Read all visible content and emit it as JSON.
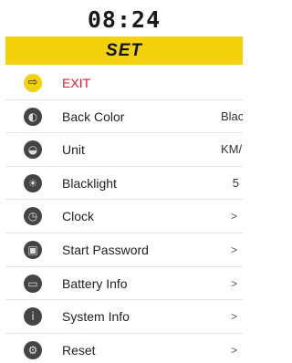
{
  "status": {
    "time": "08:24"
  },
  "header": {
    "title": "SET"
  },
  "menu": {
    "items": [
      {
        "label": "EXIT",
        "value": "",
        "icon": "exit-icon"
      },
      {
        "label": "Back Color",
        "value": "Black",
        "icon": "palette-icon"
      },
      {
        "label": "Unit",
        "value": "KM/H",
        "icon": "speedometer-icon"
      },
      {
        "label": "Blacklight",
        "value": "5",
        "icon": "brightness-icon"
      },
      {
        "label": "Clock",
        "value": ">",
        "icon": "clock-icon"
      },
      {
        "label": "Start Password",
        "value": ">",
        "icon": "lock-icon"
      },
      {
        "label": "Battery Info",
        "value": ">",
        "icon": "battery-icon"
      },
      {
        "label": "System Info",
        "value": ">",
        "icon": "info-icon"
      },
      {
        "label": "Reset",
        "value": ">",
        "icon": "reset-icon"
      }
    ]
  },
  "colors": {
    "accent": "#f3d20c",
    "exit": "#e8192c",
    "icon": "#444444"
  }
}
